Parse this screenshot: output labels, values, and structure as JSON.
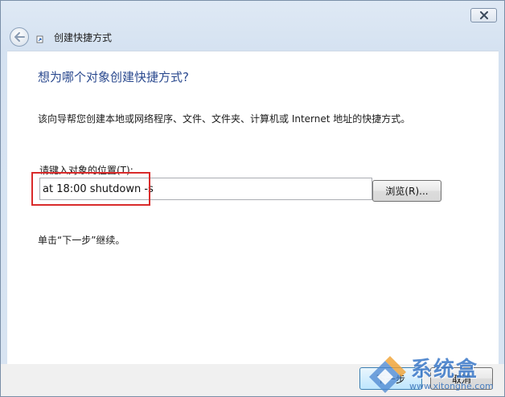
{
  "window": {
    "title": "创建快捷方式",
    "close_icon": "close-icon"
  },
  "content": {
    "heading": "想为哪个对象创建快捷方式?",
    "description": "该向导帮您创建本地或网络程序、文件、文件夹、计算机或 Internet 地址的快捷方式。",
    "location_label": "请键入对象的位置(T):",
    "location_value": "at 18:00 shutdown -s",
    "browse_label": "浏览(R)...",
    "hint": "单击“下一步”继续。"
  },
  "footer": {
    "next_label": "下一步",
    "cancel_label": "取消"
  },
  "watermark": {
    "logo_text": "系统盒",
    "url": "www.xitonghe.com"
  },
  "colors": {
    "heading": "#2b4a8f",
    "highlight": "#d92b2b",
    "accent": "#3a78c8"
  }
}
